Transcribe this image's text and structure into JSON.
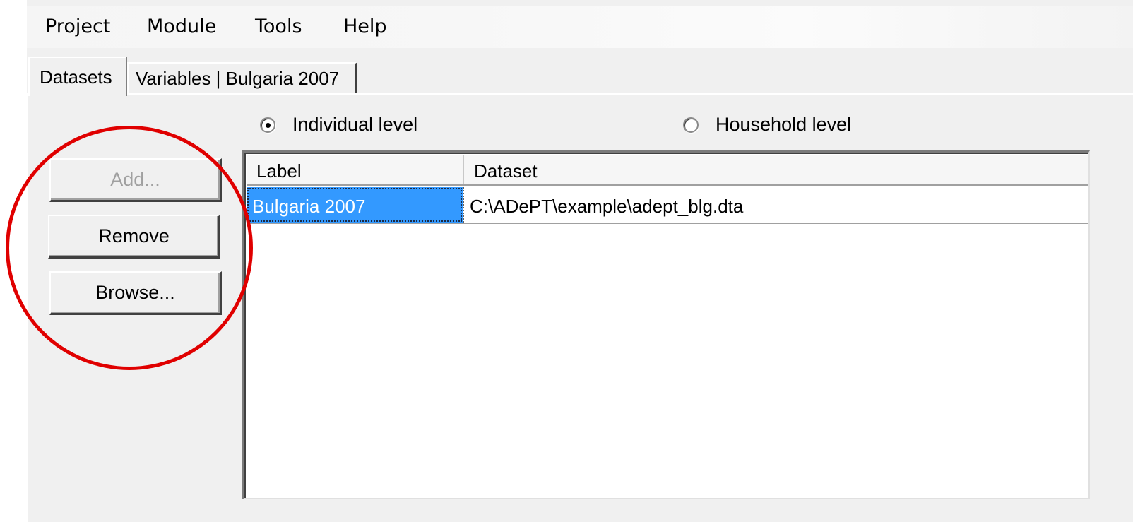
{
  "menu": {
    "items": [
      {
        "label": "Project"
      },
      {
        "label": "Module"
      },
      {
        "label": "Tools"
      },
      {
        "label": "Help"
      }
    ]
  },
  "tabs": [
    {
      "label": "Datasets",
      "active": true
    },
    {
      "label": "Variables | Bulgaria 2007",
      "active": false
    }
  ],
  "level": {
    "options": [
      {
        "label": "Individual level",
        "checked": true
      },
      {
        "label": "Household level",
        "checked": false
      }
    ]
  },
  "buttons": {
    "add": "Add...",
    "remove": "Remove",
    "browse": "Browse..."
  },
  "datasets_table": {
    "columns": [
      "Label",
      "Dataset"
    ],
    "rows": [
      {
        "label": "Bulgaria 2007",
        "dataset": "C:\\ADePT\\example\\adept_blg.dta",
        "selected": true
      }
    ]
  },
  "colors": {
    "selection": "#3399ff",
    "annotation": "#e00000"
  }
}
